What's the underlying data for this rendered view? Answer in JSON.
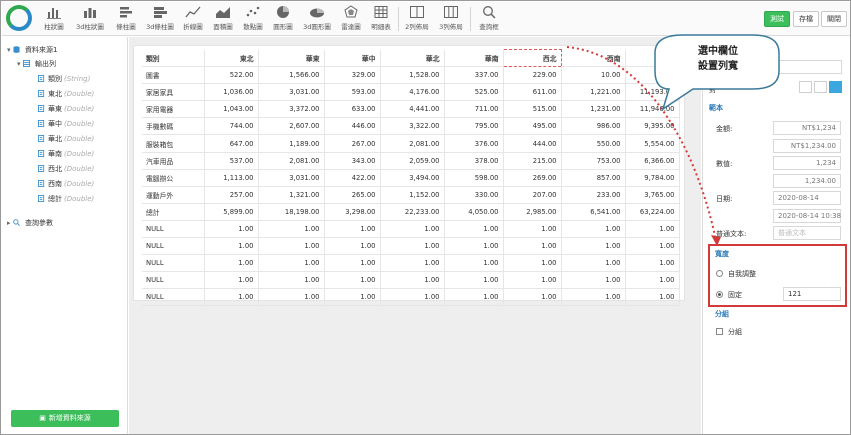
{
  "toolbar": {
    "items": [
      {
        "label": "柱狀圖",
        "icon": "bar-chart-icon"
      },
      {
        "label": "3d柱狀圖",
        "icon": "bar-3d-chart-icon"
      },
      {
        "label": "條柱圖",
        "icon": "stacked-bar-icon"
      },
      {
        "label": "3d條柱圖",
        "icon": "bar-3d-stacked-icon"
      },
      {
        "label": "折線圖",
        "icon": "line-chart-icon"
      },
      {
        "label": "面積圖",
        "icon": "area-chart-icon"
      },
      {
        "label": "散點圖",
        "icon": "scatter-chart-icon"
      },
      {
        "label": "圓形圖",
        "icon": "pie-chart-icon"
      },
      {
        "label": "3d圓形圖",
        "icon": "pie-3d-chart-icon"
      },
      {
        "label": "雷達圖",
        "icon": "radar-chart-icon"
      },
      {
        "label": "明細表",
        "icon": "detail-table-icon"
      },
      {
        "label": "2列佈局",
        "icon": "two-column-layout-icon"
      },
      {
        "label": "3列佈局",
        "icon": "three-column-layout-icon"
      },
      {
        "label": "查詢框",
        "icon": "search-icon"
      }
    ],
    "run_label": "測試",
    "save_label": "存檔",
    "close_label": "關閉"
  },
  "left_panel": {
    "datasource": "資料來源1",
    "output_columns": "輸出列",
    "fields": [
      {
        "name": "類別",
        "type": "(String)"
      },
      {
        "name": "東北",
        "type": "(Double)"
      },
      {
        "name": "華東",
        "type": "(Double)"
      },
      {
        "name": "華中",
        "type": "(Double)"
      },
      {
        "name": "華北",
        "type": "(Double)"
      },
      {
        "name": "華南",
        "type": "(Double)"
      },
      {
        "name": "西北",
        "type": "(Double)"
      },
      {
        "name": "西南",
        "type": "(Double)"
      },
      {
        "name": "總計",
        "type": "(Double)"
      }
    ],
    "query_params": "查詢參數",
    "add_datasource": "新增資料來源"
  },
  "table": {
    "headers": [
      "類別",
      "東北",
      "華東",
      "華中",
      "華北",
      "華南",
      "西北",
      "西南",
      ""
    ],
    "rows": [
      [
        "圖書",
        "522.00",
        "1,566.00",
        "329.00",
        "1,528.00",
        "337.00",
        "229.00",
        "10.00",
        ""
      ],
      [
        "家居家具",
        "1,036.00",
        "3,031.00",
        "593.00",
        "4,176.00",
        "525.00",
        "611.00",
        "1,221.00",
        "11,193.00"
      ],
      [
        "家用電器",
        "1,043.00",
        "3,372.00",
        "633.00",
        "4,441.00",
        "711.00",
        "515.00",
        "1,231.00",
        "11,946.00"
      ],
      [
        "手機數碼",
        "744.00",
        "2,607.00",
        "446.00",
        "3,322.00",
        "795.00",
        "495.00",
        "986.00",
        "9,395.00"
      ],
      [
        "服裝箱包",
        "647.00",
        "1,189.00",
        "267.00",
        "2,081.00",
        "376.00",
        "444.00",
        "550.00",
        "5,554.00"
      ],
      [
        "汽車用品",
        "537.00",
        "2,081.00",
        "343.00",
        "2,059.00",
        "378.00",
        "215.00",
        "753.00",
        "6,366.00"
      ],
      [
        "電腦辦公",
        "1,113.00",
        "3,031.00",
        "422.00",
        "3,494.00",
        "598.00",
        "269.00",
        "857.00",
        "9,784.00"
      ],
      [
        "運動戶外",
        "257.00",
        "1,321.00",
        "265.00",
        "1,152.00",
        "330.00",
        "207.00",
        "233.00",
        "3,765.00"
      ],
      [
        "總計",
        "5,899.00",
        "18,198.00",
        "3,298.00",
        "22,233.00",
        "4,050.00",
        "2,985.00",
        "6,541.00",
        "63,224.00"
      ],
      [
        "NULL",
        "1.00",
        "1.00",
        "1.00",
        "1.00",
        "1.00",
        "1.00",
        "1.00",
        "1.00"
      ],
      [
        "NULL",
        "1.00",
        "1.00",
        "1.00",
        "1.00",
        "1.00",
        "1.00",
        "1.00",
        "1.00"
      ],
      [
        "NULL",
        "1.00",
        "1.00",
        "1.00",
        "1.00",
        "1.00",
        "1.00",
        "1.00",
        "1.00"
      ],
      [
        "NULL",
        "1.00",
        "1.00",
        "1.00",
        "1.00",
        "1.00",
        "1.00",
        "1.00",
        "1.00"
      ],
      [
        "NULL",
        "1.00",
        "1.00",
        "1.00",
        "1.00",
        "1.00",
        "1.00",
        "1.00",
        "1.00"
      ]
    ]
  },
  "right_panel": {
    "partial_label": "對",
    "sample_label": "範本",
    "amount_label": "金額:",
    "amount_value1": "NT$1,234",
    "amount_value2": "NT$1,234.00",
    "number_label": "數值:",
    "number_value1": "1,234",
    "number_value2": "1,234.00",
    "date_label": "日期:",
    "date_value1": "2020-08-14",
    "date_value2": "2020-08-14 10:38",
    "text_label": "普通文本:",
    "text_placeholder": "普通文本",
    "width_section": "寬度",
    "auto_adjust": "自我調整",
    "fixed": "固定",
    "fixed_value": "121",
    "group_section": "分組",
    "group_checkbox": "分組"
  },
  "callout": {
    "line1": "選中欄位",
    "line2": "設置列寬"
  },
  "colors": {
    "accent_green": "#3cbf5a",
    "link_blue": "#2a7ab8",
    "highlight_red": "#d23a3a",
    "align_active": "#3aa7df"
  }
}
